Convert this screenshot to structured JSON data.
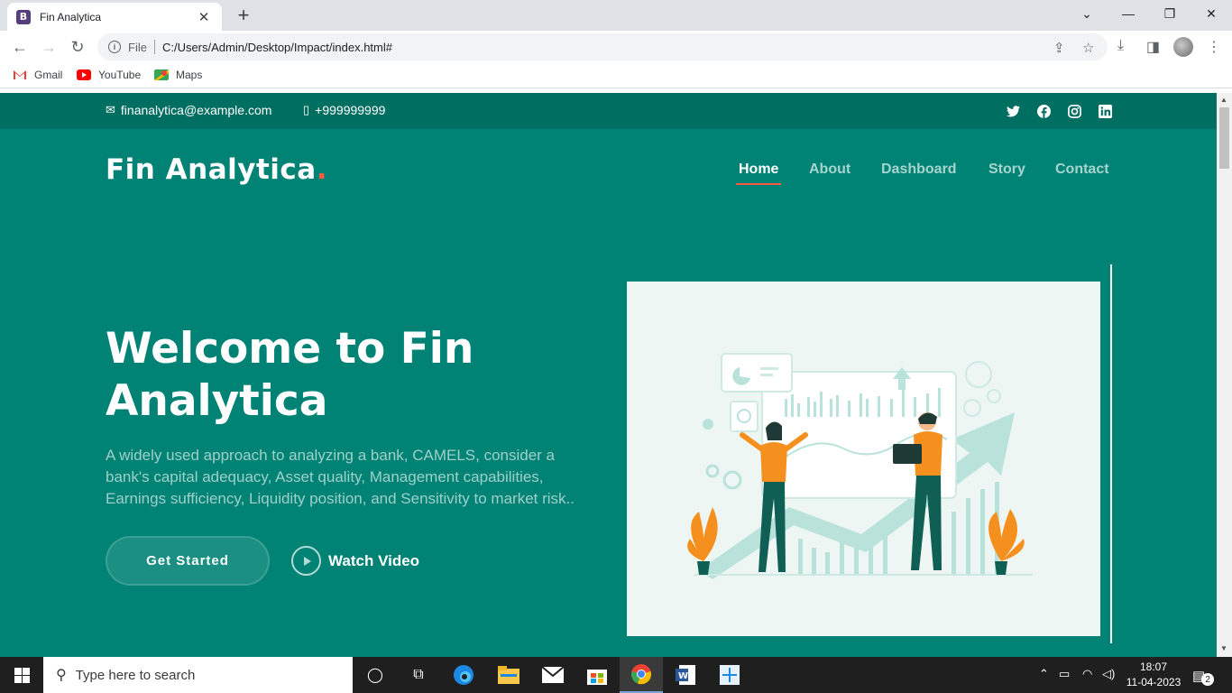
{
  "browser": {
    "tab_title": "Fin Analytica",
    "tab_favicon_letter": "B",
    "url_scheme": "File",
    "url": "C:/Users/Admin/Desktop/Impact/index.html#",
    "bookmarks": [
      {
        "label": "Gmail",
        "icon": "gmail-icon",
        "color": "#ea4335"
      },
      {
        "label": "YouTube",
        "icon": "youtube-icon",
        "color": "#ff0000"
      },
      {
        "label": "Maps",
        "icon": "maps-icon",
        "color": "#34a853"
      }
    ]
  },
  "page": {
    "topbar": {
      "email": "finanalytica@example.com",
      "phone": "+999999999",
      "social": [
        "twitter-icon",
        "facebook-icon",
        "instagram-icon",
        "linkedin-icon"
      ]
    },
    "logo": {
      "text": "Fin Analytica",
      "dot": "."
    },
    "nav": [
      "Home",
      "About",
      "Dashboard",
      "Story",
      "Contact"
    ],
    "hero": {
      "title": "Welcome to Fin Analytica",
      "text": "A widely used approach to analyzing a bank, CAMELS, consider a bank's capital adequacy, Asset quality, Management capabilities, Earnings sufficiency, Liquidity position, and Sensitivity to market risk..",
      "cta": "Get Started",
      "video": "Watch Video"
    },
    "colors": {
      "primary": "#008374",
      "topbar": "#006e61",
      "accent": "#f85a40",
      "illustration_orange": "#f5901e"
    }
  },
  "taskbar": {
    "search_placeholder": "Type here to search",
    "time": "18:07",
    "date": "11-04-2023",
    "notifications": "2"
  }
}
